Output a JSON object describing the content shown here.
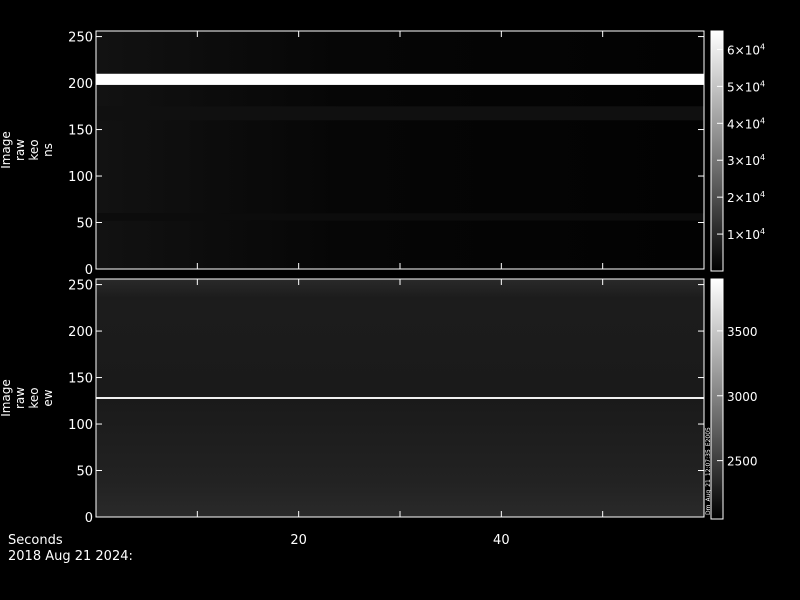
{
  "chart_data": [
    {
      "type": "heatmap",
      "ylabel": [
        "Image",
        "raw",
        "keo",
        "ns"
      ],
      "x_range": [
        0,
        60
      ],
      "y_range": [
        0,
        256
      ],
      "y_ticks": [
        0,
        50,
        100,
        150,
        200,
        250
      ],
      "y_tick_labels": [
        "0",
        "50",
        "100",
        "150",
        "200",
        "250"
      ],
      "colorbar": {
        "range": [
          0,
          65000
        ],
        "ticks": [
          10000,
          20000,
          30000,
          40000,
          50000,
          60000
        ],
        "tick_mantissas": [
          "1",
          "2",
          "3",
          "4",
          "5",
          "6"
        ],
        "tick_suffix": "×10",
        "tick_exponent": "4"
      },
      "features": [
        {
          "kind": "bright_band",
          "y_from": 198,
          "y_to": 210,
          "level": 65000
        },
        {
          "kind": "faint_band",
          "y_from": 160,
          "y_to": 175,
          "level": 4000
        },
        {
          "kind": "faint_band",
          "y_from": 52,
          "y_to": 60,
          "level": 3000
        }
      ]
    },
    {
      "type": "heatmap",
      "ylabel": [
        "Image",
        "raw",
        "keo",
        "ew"
      ],
      "x_range": [
        0,
        60
      ],
      "y_range": [
        0,
        256
      ],
      "y_ticks": [
        0,
        50,
        100,
        150,
        200,
        250
      ],
      "y_tick_labels": [
        "0",
        "50",
        "100",
        "150",
        "200",
        "250"
      ],
      "colorbar": {
        "range": [
          2050,
          3900
        ],
        "ticks": [
          2500,
          3000,
          3500
        ],
        "tick_labels": [
          "2500",
          "3000",
          "3500"
        ],
        "side_text": "Dm_Aug_21_12:07:35_E2005"
      },
      "features": [
        {
          "kind": "bright_line",
          "y": 128,
          "level": 3800
        }
      ]
    }
  ],
  "x_axis": {
    "label": "Seconds",
    "ticks": [
      20,
      40
    ],
    "tick_labels": [
      "20",
      "40"
    ]
  },
  "date_label": "2018 Aug 21 2024:"
}
